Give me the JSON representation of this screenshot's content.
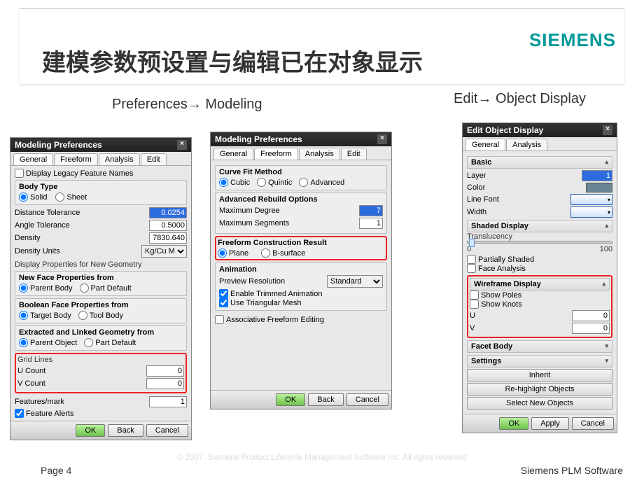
{
  "slide": {
    "title": "建模参数预设置与编辑已在对象显示",
    "logo": "SIEMENS",
    "breadcrumb_left": "Preferences→ Modeling",
    "breadcrumb_right": "Edit→ Object Display",
    "copyright": "© 2007. Siemens Product Lifecycle Management Software Inc. All rights reserved",
    "page": "Page 4",
    "brand": "Siemens PLM Software"
  },
  "dlg1": {
    "title": "Modeling Preferences",
    "tabs": {
      "general": "General",
      "freeform": "Freeform",
      "analysis": "Analysis",
      "edit": "Edit"
    },
    "legacy": "Display Legacy Feature Names",
    "body_type": {
      "title": "Body Type",
      "solid": "Solid",
      "sheet": "Sheet"
    },
    "dist_tol": {
      "label": "Distance Tolerance",
      "value": "0.0254"
    },
    "ang_tol": {
      "label": "Angle Tolerance",
      "value": "0.5000"
    },
    "density": {
      "label": "Density",
      "value": "7830.640"
    },
    "density_units": {
      "label": "Density Units",
      "value": "Kg/Cu M"
    },
    "disp_props": "Display Properties for New Geometry",
    "nfp": {
      "title": "New Face Properties from",
      "a": "Parent Body",
      "b": "Part Default"
    },
    "bfp": {
      "title": "Boolean Face Properties from",
      "a": "Target Body",
      "b": "Tool Body"
    },
    "elg": {
      "title": "Extracted and Linked Geometry from",
      "a": "Parent Object",
      "b": "Part Default"
    },
    "grid": {
      "title": "Grid Lines",
      "u": "U Count",
      "v": "V Count",
      "uv": "0",
      "vv": "0"
    },
    "feat_mark": {
      "label": "Features/mark",
      "value": "1"
    },
    "feat_alerts": "Feature Alerts",
    "btns": {
      "ok": "OK",
      "back": "Back",
      "cancel": "Cancel"
    }
  },
  "dlg2": {
    "title": "Modeling Preferences",
    "curve_fit": {
      "title": "Curve Fit Method",
      "cubic": "Cubic",
      "quintic": "Quintic",
      "adv": "Advanced"
    },
    "adv_rebuild": {
      "title": "Advanced Rebuild Options",
      "max_deg": "Maximum Degree",
      "max_deg_v": "7",
      "max_seg": "Maximum Segments",
      "max_seg_v": "1"
    },
    "ffcr": {
      "title": "Freeform Construction Result",
      "plane": "Plane",
      "bsurf": "B-surface"
    },
    "anim": {
      "title": "Animation",
      "res": "Preview Resolution",
      "res_v": "Standard",
      "trim": "Enable Trimmed Animation",
      "tri": "Use Triangular Mesh"
    },
    "assoc": "Associative Freeform Editing"
  },
  "dlg3": {
    "title": "Edit Object Display",
    "tabs": {
      "general": "General",
      "analysis": "Analysis"
    },
    "basic": {
      "title": "Basic",
      "layer": "Layer",
      "layer_v": "1",
      "color": "Color",
      "linefont": "Line Font",
      "width": "Width"
    },
    "shaded": {
      "title": "Shaded Display",
      "trans": "Translucency",
      "zero": "0",
      "hundred": "100",
      "partial": "Partially Shaded",
      "face": "Face Analysis"
    },
    "wire": {
      "title": "Wireframe Display",
      "poles": "Show Poles",
      "knots": "Show Knots",
      "u": "U",
      "v": "V",
      "uv": "0",
      "vv": "0"
    },
    "facet": "Facet Body",
    "settings": "Settings",
    "actions": {
      "inherit": "Inherit",
      "rehl": "Re-highlight Objects",
      "seln": "Select New Objects"
    },
    "btns": {
      "ok": "OK",
      "apply": "Apply",
      "cancel": "Cancel"
    }
  }
}
